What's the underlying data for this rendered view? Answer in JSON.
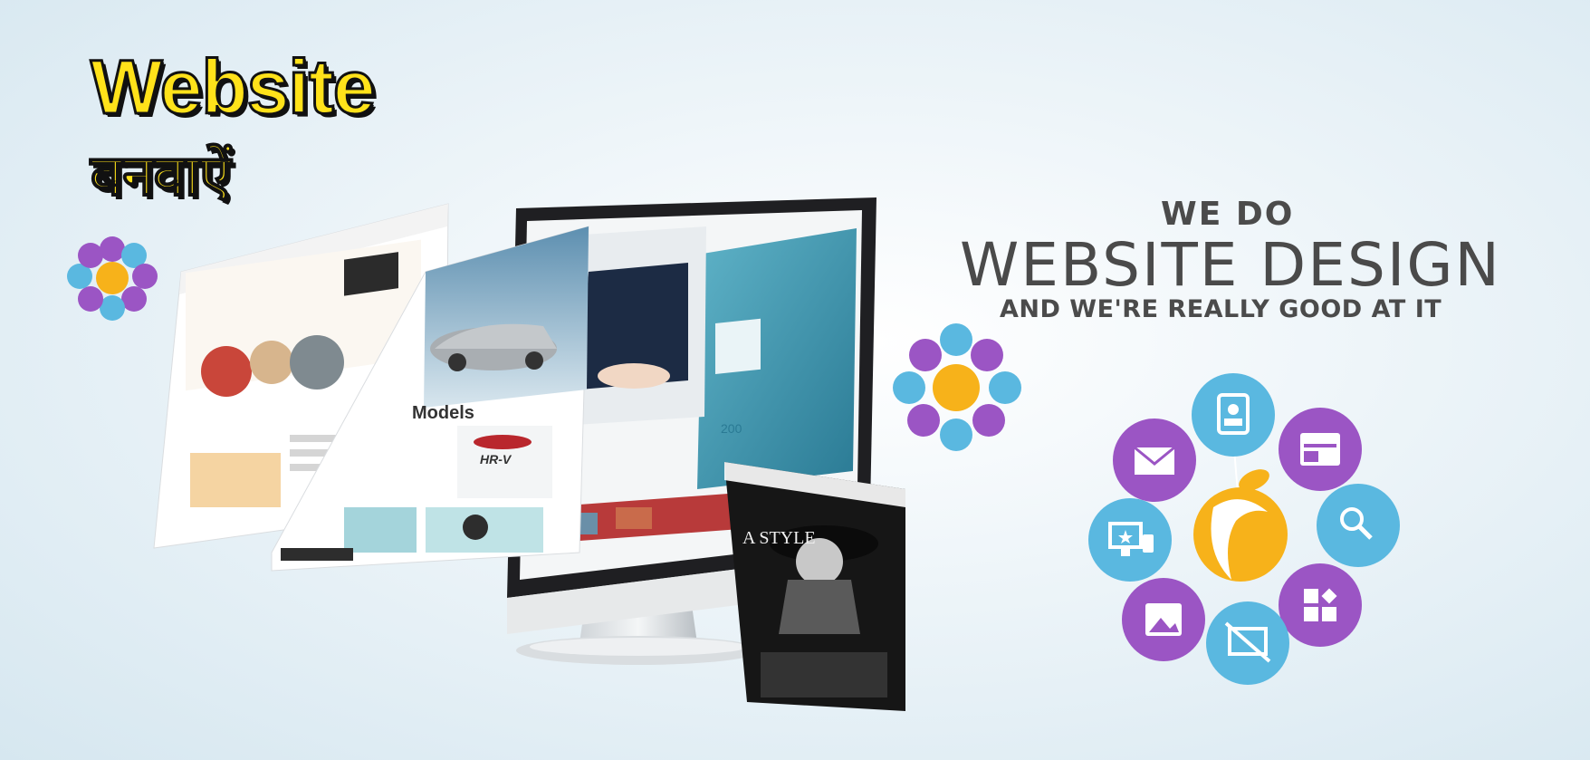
{
  "headline": {
    "english": "Website",
    "hindi": "बनवाऐं"
  },
  "tagline": {
    "line1": "WE DO",
    "line2": "WEBSITE DESIGN",
    "line3": "AND WE'RE REALLY GOOD AT IT"
  },
  "mockups": {
    "car_card_heading": "Models",
    "car_model": "HR-V",
    "fashion_caption": "A STYLE",
    "dashboard_number": "200"
  },
  "icons": [
    "id-card-icon",
    "browser-window-icon",
    "search-icon",
    "app-grid-icon",
    "no-mobile-icon",
    "image-icon",
    "responsive-devices-icon",
    "email-icon",
    "logo-swirl-icon"
  ],
  "colors": {
    "purple": "#9b55c4",
    "blue": "#5ab8e0",
    "orange": "#f7b21a",
    "yellow": "#ffe21a"
  }
}
